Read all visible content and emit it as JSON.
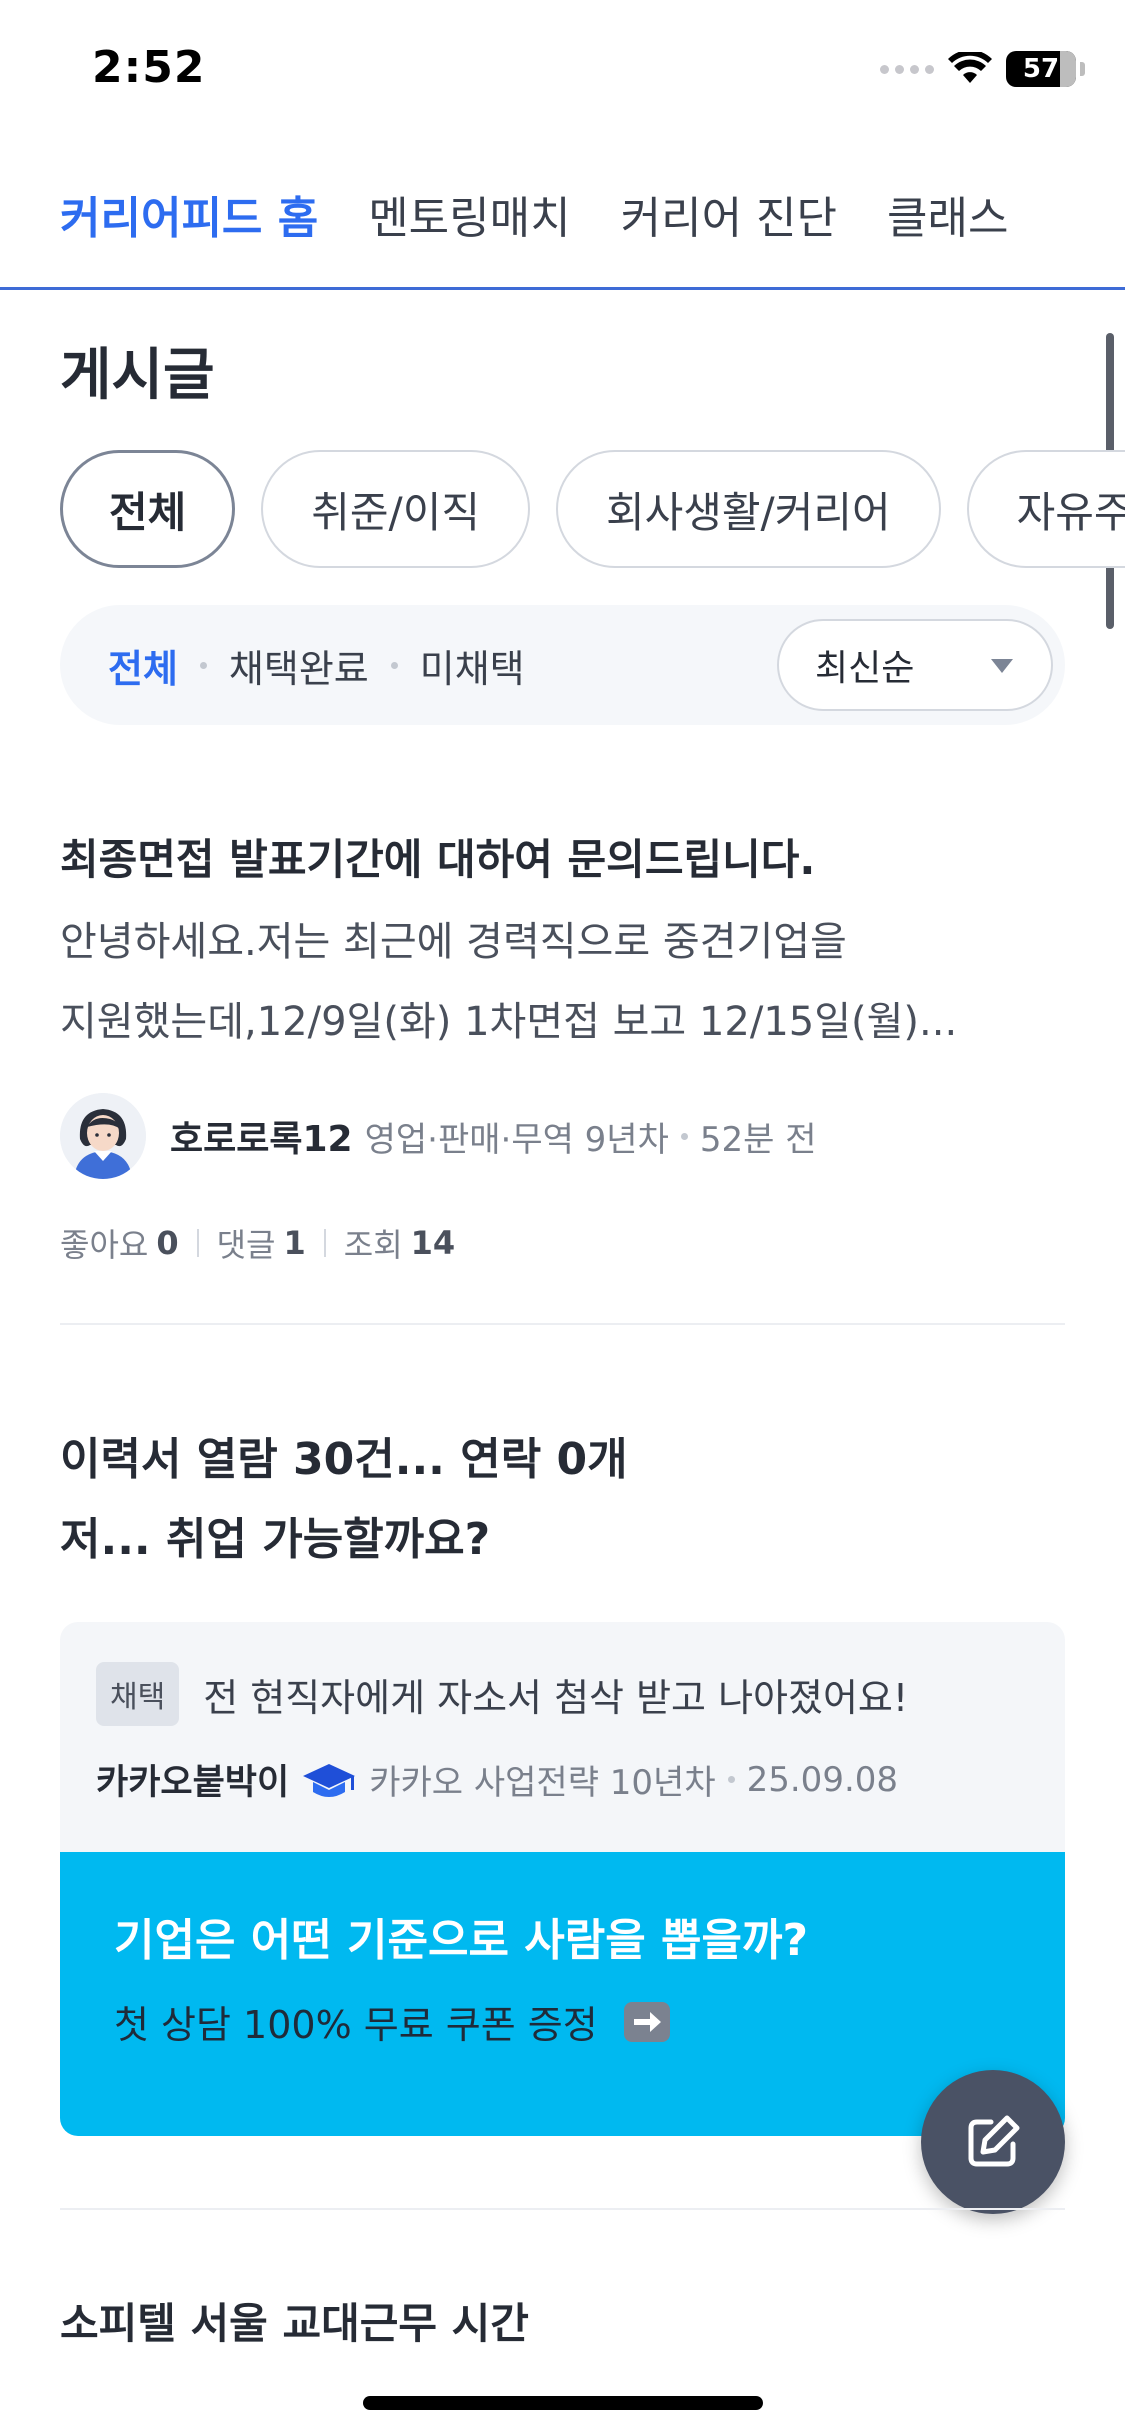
{
  "status_bar": {
    "time": "2:52",
    "battery": "57"
  },
  "top_tabs": [
    {
      "label": "커리어피드 홈",
      "active": true
    },
    {
      "label": "멘토링매치",
      "active": false
    },
    {
      "label": "커리어 진단",
      "active": false
    },
    {
      "label": "클래스",
      "active": false
    }
  ],
  "section_title": "게시글",
  "categories": [
    "전체",
    "취준/이직",
    "회사생활/커리어",
    "자유주제"
  ],
  "filters": {
    "all": "전체",
    "adopted": "채택완료",
    "not_adopted": "미채택"
  },
  "sort": {
    "selected": "최신순"
  },
  "post1": {
    "title": "최종면접 발표기간에 대하여 문의드립니다.",
    "excerpt_line1": "안녕하세요.저는 최근에 경력직으로 중견기업을",
    "excerpt_line2": "지원했는데,12/9일(화) 1차면접 보고 12/15일(월)...",
    "author": "호로로록12",
    "author_meta": "영업·판매·무역 9년차",
    "time": "52분 전",
    "likes_label": "좋아요",
    "likes": "0",
    "comments_label": "댓글",
    "comments": "1",
    "views_label": "조회",
    "views": "14"
  },
  "post2": {
    "title_line1": "이력서 열람 30건... 연락 0개",
    "title_line2": "저... 취업 가능할까요?",
    "answer_badge": "채택",
    "answer_text": "전 현직자에게 자소서 첨삭 받고 나아졌어요!",
    "answer_author": "카카오붙박이",
    "answer_meta": "카카오 사업전략 10년차",
    "answer_date": "25.09.08"
  },
  "promo": {
    "title": "기업은 어떤 기준으로 사람을 뽑을까?",
    "subtitle": "첫 상담 100% 무료 쿠폰 증정"
  },
  "post3": {
    "title": "소피텔 서울 교대근무 시간"
  },
  "colors": {
    "accent": "#2d6cf0",
    "promo_bg": "#00b9f0",
    "fab_bg": "#4a5265"
  }
}
